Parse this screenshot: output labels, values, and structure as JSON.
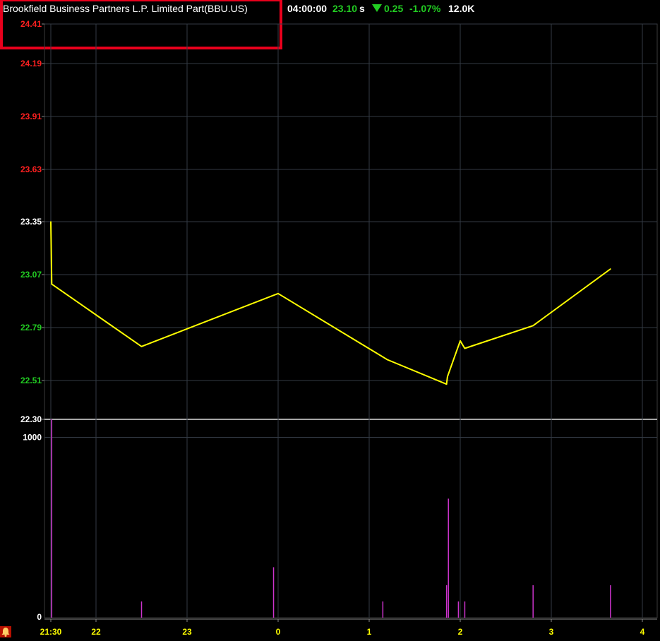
{
  "header": {
    "title": "Brookfield Business Partners L.P. Limited Part(BBU.US)",
    "time": "04:00:00",
    "price": "23.10",
    "price_suffix": "s",
    "change": "0.25",
    "change_pct": "-1.07%",
    "volume": "12.0K"
  },
  "colors": {
    "background": "#000000",
    "price_line": "#ffff00",
    "volume_bars": "#cc33cc",
    "up": "#ff2020",
    "down": "#22cc22",
    "neutral": "#ffffff",
    "axis_ticks": "#ffff00",
    "highlight_box": "#e8001c"
  },
  "icons": {
    "alarm": "bell-alarm-icon"
  },
  "chart_data": {
    "type": "line",
    "price_axis": {
      "ticks": [
        "24.41",
        "24.19",
        "23.91",
        "23.63",
        "23.35",
        "23.07",
        "22.79",
        "22.51",
        "22.30"
      ],
      "tick_colors": [
        "up",
        "up",
        "up",
        "up",
        "neutral",
        "down",
        "down",
        "down",
        "neutral"
      ],
      "ylim": [
        22.3,
        24.41
      ],
      "reference_price": 23.35
    },
    "volume_axis": {
      "ticks": [
        "1000",
        "0"
      ],
      "ylim": [
        0,
        1100
      ]
    },
    "time_axis": {
      "ticks": [
        "21:30",
        "22",
        "23",
        "0",
        "1",
        "2",
        "3",
        "4"
      ]
    },
    "price_series": {
      "x": [
        0.0,
        0.01,
        1.0,
        2.5,
        3.7,
        4.35,
        4.36,
        4.5,
        4.55,
        5.3,
        6.15
      ],
      "y": [
        23.35,
        23.02,
        22.69,
        22.97,
        22.62,
        22.49,
        22.53,
        22.72,
        22.68,
        22.8,
        23.1
      ]
    },
    "volume_series": {
      "x": [
        0.01,
        1.0,
        2.45,
        3.65,
        4.35,
        4.37,
        4.48,
        4.55,
        5.3,
        6.15
      ],
      "values": [
        1100,
        90,
        280,
        90,
        180,
        660,
        90,
        90,
        180,
        180
      ]
    }
  }
}
